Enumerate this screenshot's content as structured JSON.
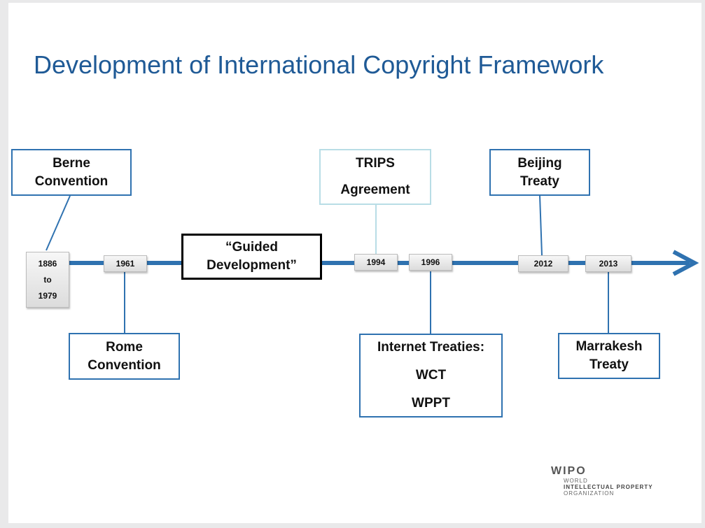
{
  "title": "Development of International Copyright Framework",
  "accent_color": "#2f72b0",
  "timeline": {
    "years": [
      "1886",
      "to",
      "1979",
      "1961",
      "1994",
      "1996",
      "2012",
      "2013"
    ],
    "above": {
      "berne": [
        "Berne",
        "Convention"
      ],
      "guided": [
        "“Guided",
        "Development”"
      ],
      "trips": [
        "TRIPS",
        "Agreement"
      ],
      "beijing": [
        "Beijing",
        "Treaty"
      ]
    },
    "below": {
      "rome": [
        "Rome",
        "Convention"
      ],
      "internet": [
        "Internet Treaties:",
        "WCT",
        "WPPT"
      ],
      "marrakesh": [
        "Marrakesh",
        "Treaty"
      ]
    }
  },
  "logo": {
    "name": "WIPO",
    "line1": "WORLD",
    "line2": "INTELLECTUAL PROPERTY",
    "line3": "ORGANIZATION"
  }
}
